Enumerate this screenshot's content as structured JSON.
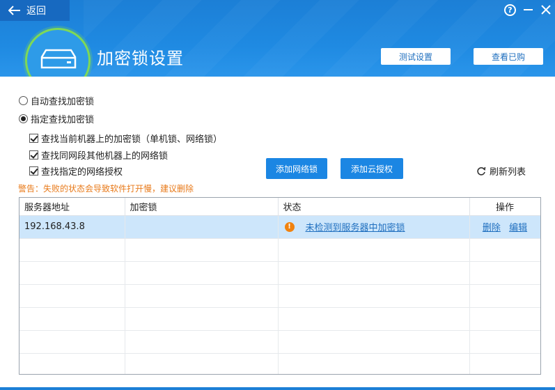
{
  "header": {
    "back_label": "返回",
    "title": "加密锁设置",
    "test_button": "测试设置",
    "view_button": "查看已购",
    "help_symbol": "?",
    "accent_color": "#1c7fd6"
  },
  "options": {
    "auto_find": "自动查找加密锁",
    "specified_find": "指定查找加密锁",
    "selected": "specified_find"
  },
  "checkboxes": [
    {
      "label": "查找当前机器上的加密锁（单机锁、网络锁）",
      "checked": true
    },
    {
      "label": "查找同网段其他机器上的网络锁",
      "checked": true
    },
    {
      "label": "查找指定的网络授权",
      "checked": true
    }
  ],
  "actions": {
    "add_network_lock": "添加网络锁",
    "add_cloud_license": "添加云授权",
    "refresh_list": "刷新列表"
  },
  "warning": "警告：失败的状态会导致软件打开慢，建议删除",
  "table": {
    "columns": [
      "服务器地址",
      "加密锁",
      "状态",
      "操作"
    ],
    "rows": [
      {
        "server": "192.168.43.8",
        "lock": "",
        "status": "未检测到服务器中加密锁",
        "status_icon": "warning-icon",
        "op_delete": "删除",
        "op_edit": "编辑"
      }
    ]
  }
}
